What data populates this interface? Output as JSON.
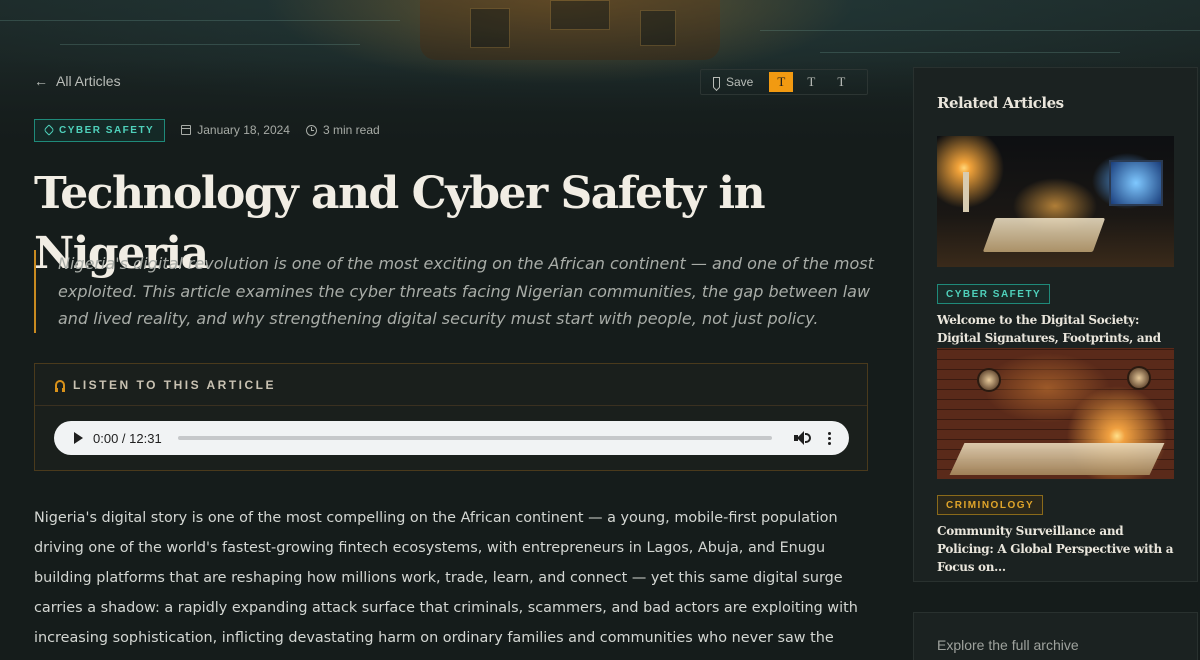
{
  "nav": {
    "back_label": "All Articles"
  },
  "toolbar": {
    "save_label": "Save",
    "text_sizes": [
      "T",
      "T",
      "T"
    ],
    "active_size_index": 0,
    "accent_color": "#f29a11"
  },
  "article": {
    "category": "CYBER SAFETY",
    "date": "January 18, 2024",
    "read_time": "3 min read",
    "title": "Technology and Cyber Safety in Nigeria",
    "lede": "Nigeria's digital revolution is one of the most exciting on the African continent — and one of the most exploited. This article examines the cyber threats facing Nigerian communities, the gap between law and lived reality, and why strengthening digital security must start with people, not just policy.",
    "body": "Nigeria's digital story is one of the most compelling on the African continent — a young, mobile-first population driving one of the world's fastest-growing fintech ecosystems, with entrepreneurs in Lagos, Abuja, and Enugu building platforms that are reshaping how millions work, trade, learn, and connect — yet this same digital surge carries a shadow: a rapidly expanding attack surface that criminals, scammers, and bad actors are exploiting with increasing sophistication, inflicting devastating harm on ordinary families and communities who never saw the threat coming."
  },
  "audio": {
    "heading": "LISTEN TO THIS ARTICLE",
    "time_display": "0:00 / 12:31",
    "progress": 0
  },
  "sidebar": {
    "title": "Related Articles",
    "items": [
      {
        "tag": "CYBER SAFETY",
        "title": "Welcome to the Digital Society: Digital Signatures, Footprints, and the Forever..."
      },
      {
        "tag": "CRIMINOLOGY",
        "title": "Community Surveillance and Policing: A Global Perspective with a Focus on..."
      }
    ],
    "archive_label": "Explore the full archive"
  }
}
